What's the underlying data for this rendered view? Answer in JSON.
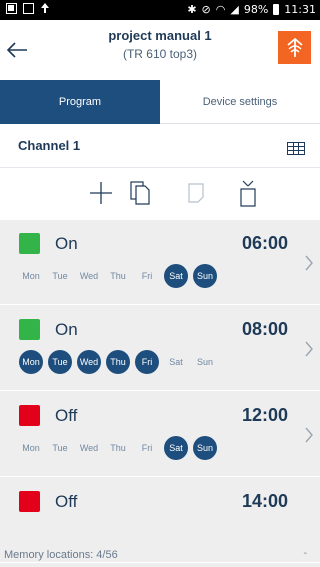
{
  "status_bar": {
    "icons_left": [
      "gallery-icon",
      "screenshot-icon",
      "upload-icon"
    ],
    "icons_right": [
      "bluetooth-icon",
      "mute-icon",
      "wifi-icon",
      "signal-icon",
      "battery-icon"
    ],
    "battery": "98%",
    "time": "11:31"
  },
  "header": {
    "title": "project manual 1",
    "subtitle": "(TR 610 top3)",
    "back_icon": "arrow-left-icon",
    "transfer_icon": "transfer-upload-icon"
  },
  "colors": {
    "primary": "#1d4e7d",
    "accent_orange": "#f26522",
    "on_green": "#33b449",
    "off_red": "#e2001a",
    "list_bg": "#eeeeef"
  },
  "tabs": [
    {
      "label": "Program",
      "active": true
    },
    {
      "label": "Device settings",
      "active": false
    }
  ],
  "channel": {
    "label": "Channel 1",
    "view_icon": "grid-view-icon"
  },
  "toolbar": {
    "icons": [
      "add-icon",
      "copy-icon",
      "paste-icon",
      "delete-icon"
    ]
  },
  "programs": [
    {
      "state": "On",
      "time": "06:00",
      "days": [
        {
          "label": "Mon",
          "on": false
        },
        {
          "label": "Tue",
          "on": false
        },
        {
          "label": "Wed",
          "on": false
        },
        {
          "label": "Thu",
          "on": false
        },
        {
          "label": "Fri",
          "on": false
        },
        {
          "label": "Sat",
          "on": true
        },
        {
          "label": "Sun",
          "on": true
        }
      ]
    },
    {
      "state": "On",
      "time": "08:00",
      "days": [
        {
          "label": "Mon",
          "on": true
        },
        {
          "label": "Tue",
          "on": true
        },
        {
          "label": "Wed",
          "on": true
        },
        {
          "label": "Thu",
          "on": true
        },
        {
          "label": "Fri",
          "on": true
        },
        {
          "label": "Sat",
          "on": false
        },
        {
          "label": "Sun",
          "on": false
        }
      ]
    },
    {
      "state": "Off",
      "time": "12:00",
      "days": [
        {
          "label": "Mon",
          "on": false
        },
        {
          "label": "Tue",
          "on": false
        },
        {
          "label": "Wed",
          "on": false
        },
        {
          "label": "Thu",
          "on": false
        },
        {
          "label": "Fri",
          "on": false
        },
        {
          "label": "Sat",
          "on": true
        },
        {
          "label": "Sun",
          "on": true
        }
      ]
    },
    {
      "state": "Off",
      "time": "14:00",
      "days": []
    }
  ],
  "memory_locations": "Memory locations: 4/56"
}
